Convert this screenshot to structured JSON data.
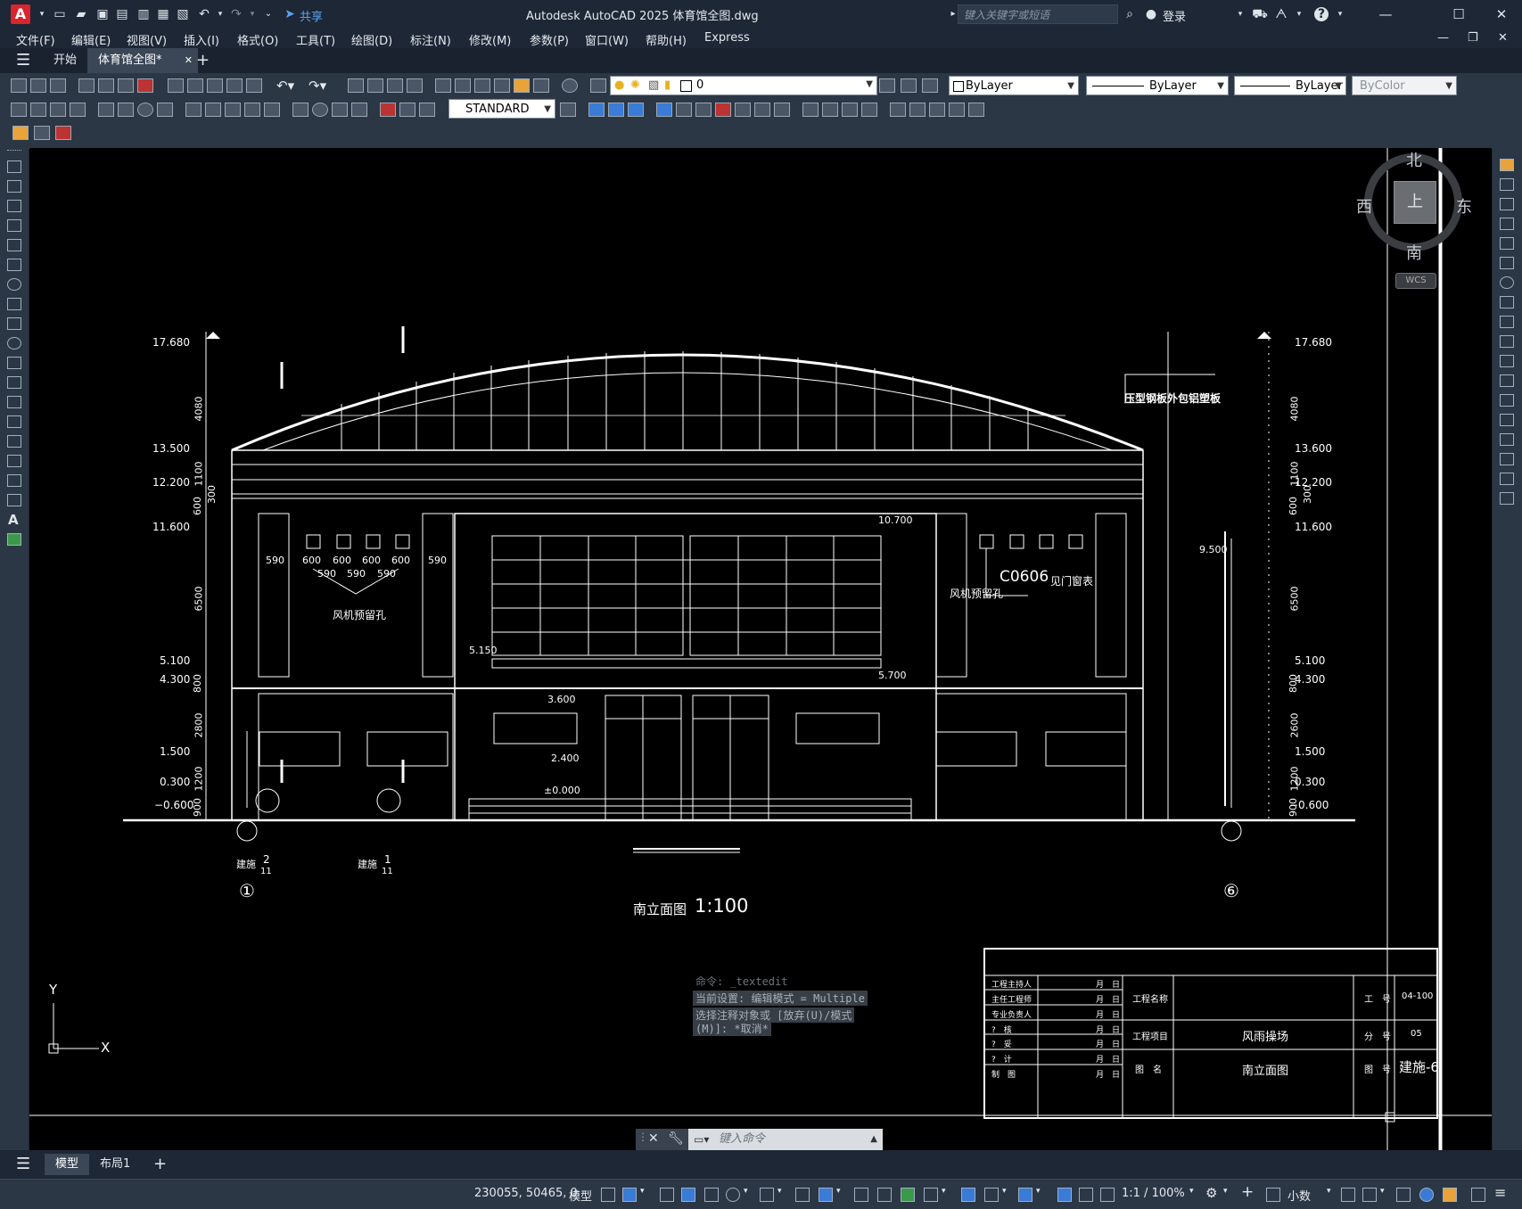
{
  "titlebar": {
    "app_logo": "A",
    "share_label": "共享",
    "title": "Autodesk AutoCAD 2025    体育馆全图.dwg",
    "search_placeholder": "键入关键字或短语",
    "login_label": "登录",
    "help_label": "?"
  },
  "menubar": {
    "items": [
      "文件(F)",
      "编辑(E)",
      "视图(V)",
      "插入(I)",
      "格式(O)",
      "工具(T)",
      "绘图(D)",
      "标注(N)",
      "修改(M)",
      "参数(P)",
      "窗口(W)",
      "帮助(H)",
      "Express"
    ]
  },
  "tabs": {
    "start": "开始",
    "drawing": "体育馆全图*",
    "add": "+"
  },
  "toolbar": {
    "layer_value": "0",
    "text_style": "STANDARD",
    "color_value": "ByLayer",
    "linetype_value": "ByLayer",
    "lineweight_value": "ByLayer",
    "plotstyle_value": "ByColor"
  },
  "viewcube": {
    "north": "北",
    "south": "南",
    "east": "东",
    "west": "西",
    "top_face": "上",
    "wcs": "WCS"
  },
  "drawing": {
    "left_levels": [
      "17.680",
      "13.500",
      "12.200",
      "11.600",
      "5.100",
      "4.300",
      "1.500",
      "0.300",
      "−0.600"
    ],
    "right_levels": [
      "17.680",
      "13.600",
      "12.200",
      "11.600",
      "5.100",
      "4.300",
      "1.500",
      "0.300",
      "−0.600"
    ],
    "left_dims": [
      "4080",
      "1100",
      "600",
      "300",
      "6500",
      "800",
      "2800",
      "1200",
      "900"
    ],
    "right_dims": [
      "4080",
      "1100",
      "600",
      "300",
      "6500",
      "800",
      "2600",
      "1200",
      "900"
    ],
    "opening_top": [
      "590",
      "600",
      "600",
      "600",
      "600",
      "590"
    ],
    "opening_bottom": [
      "590",
      "590",
      "590"
    ],
    "fan_hole_label": "风机预留孔",
    "fan_hole_label_right": "风机预留孔",
    "window_tag": "C0606",
    "window_tag_note": "见门窗表",
    "roof_note": "压型钢板外包铝塑板",
    "level_10700": "10.700",
    "level_9500": "9.500",
    "level_5150": "5.150",
    "level_5700": "5.700",
    "level_3600": "3.600",
    "level_2400": "2.400",
    "level_0": "±0.000",
    "section_ref": "建施",
    "section_num_2": "2",
    "section_num_1": "1",
    "section_sheet": "11",
    "axis_1": "①",
    "axis_6": "⑥",
    "view_title": "南立面图",
    "view_scale": "1:100",
    "ucs_y": "Y",
    "ucs_x": "X"
  },
  "titleblock": {
    "roles": [
      "工程主持人",
      "主任工程师",
      "专业负责人",
      "?　核",
      "?　妥",
      "?　计",
      "制　图"
    ],
    "date_label": "月　日",
    "project_name_label": "工程名称",
    "project_item_label": "工程项目",
    "project_item_value": "风雨操场",
    "drawing_name_label": "图　名",
    "drawing_name_value": "南立面图",
    "job_no_label": "工　号",
    "job_no_value": "04-100",
    "sub_no_label": "分　号",
    "sub_no_value": "05",
    "sheet_label": "图　号",
    "sheet_value": "建施-6"
  },
  "command": {
    "history": [
      "命令: _textedit",
      "当前设置: 编辑模式 = Multiple",
      "选择注释对象或 [放弃(U)/模式",
      "(M)]: *取消*"
    ],
    "input_placeholder": "键入命令"
  },
  "layout_tabs": {
    "model": "模型",
    "layout1": "布局1",
    "add": "+"
  },
  "statusbar": {
    "coords": "230055, 50465, 0",
    "model_label": "模型",
    "scale": "1:1 / 100%",
    "units": "小数"
  }
}
